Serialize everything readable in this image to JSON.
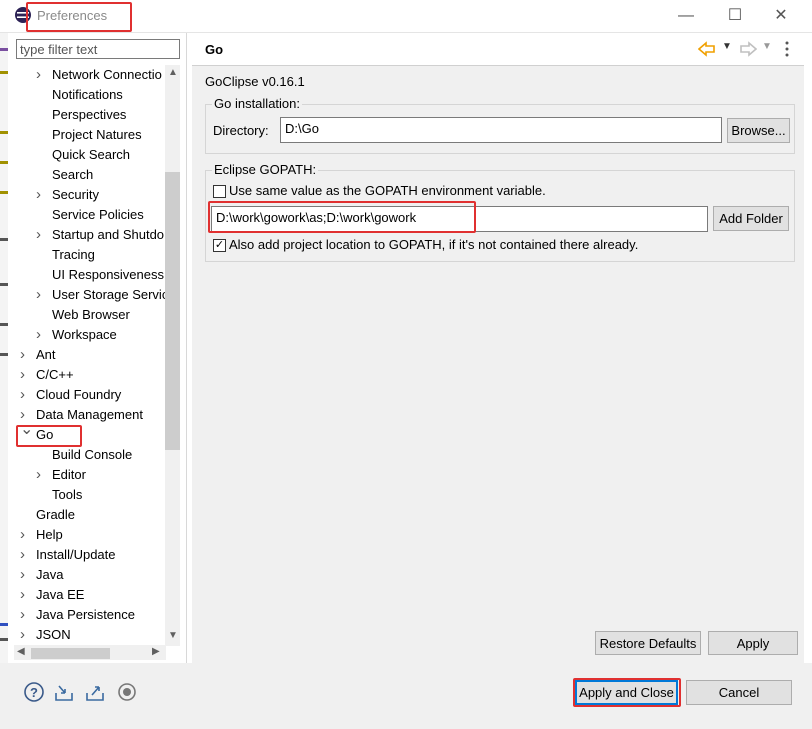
{
  "window": {
    "title": "Preferences",
    "minimize_glyph": "—",
    "maximize_glyph": "☐",
    "close_glyph": "✕"
  },
  "filter": {
    "placeholder": "type filter text"
  },
  "tree": [
    {
      "label": "Network Connectio",
      "level": 1,
      "twisty": "right"
    },
    {
      "label": "Notifications",
      "level": 1,
      "twisty": ""
    },
    {
      "label": "Perspectives",
      "level": 1,
      "twisty": ""
    },
    {
      "label": "Project Natures",
      "level": 1,
      "twisty": ""
    },
    {
      "label": "Quick Search",
      "level": 1,
      "twisty": ""
    },
    {
      "label": "Search",
      "level": 1,
      "twisty": ""
    },
    {
      "label": "Security",
      "level": 1,
      "twisty": "right"
    },
    {
      "label": "Service Policies",
      "level": 1,
      "twisty": ""
    },
    {
      "label": "Startup and Shutdo",
      "level": 1,
      "twisty": "right"
    },
    {
      "label": "Tracing",
      "level": 1,
      "twisty": ""
    },
    {
      "label": "UI Responsiveness",
      "level": 1,
      "twisty": ""
    },
    {
      "label": "User Storage Servic",
      "level": 1,
      "twisty": "right"
    },
    {
      "label": "Web Browser",
      "level": 1,
      "twisty": ""
    },
    {
      "label": "Workspace",
      "level": 1,
      "twisty": "right"
    },
    {
      "label": "Ant",
      "level": 0,
      "twisty": "right"
    },
    {
      "label": "C/C++",
      "level": 0,
      "twisty": "right"
    },
    {
      "label": "Cloud Foundry",
      "level": 0,
      "twisty": "right"
    },
    {
      "label": "Data Management",
      "level": 0,
      "twisty": "right"
    },
    {
      "label": "Go",
      "level": 0,
      "twisty": "down"
    },
    {
      "label": "Build Console",
      "level": 1,
      "twisty": ""
    },
    {
      "label": "Editor",
      "level": 1,
      "twisty": "right"
    },
    {
      "label": "Tools",
      "level": 1,
      "twisty": ""
    },
    {
      "label": "Gradle",
      "level": 0,
      "twisty": ""
    },
    {
      "label": "Help",
      "level": 0,
      "twisty": "right"
    },
    {
      "label": "Install/Update",
      "level": 0,
      "twisty": "right"
    },
    {
      "label": "Java",
      "level": 0,
      "twisty": "right"
    },
    {
      "label": "Java EE",
      "level": 0,
      "twisty": "right"
    },
    {
      "label": "Java Persistence",
      "level": 0,
      "twisty": "right"
    },
    {
      "label": "JSON",
      "level": 0,
      "twisty": "right"
    }
  ],
  "page": {
    "title": "Go",
    "version": "GoClipse v0.16.1",
    "install_group": {
      "title": "Go installation:",
      "directory_label": "Directory:",
      "directory_value": "D:\\Go",
      "browse": "Browse..."
    },
    "gopath_group": {
      "title": "Eclipse GOPATH:",
      "same_value_label": "Use same value as the GOPATH environment variable.",
      "same_value_checked": false,
      "gopath_value": "D:\\work\\gowork\\as;D:\\work\\gowork",
      "add_folder": "Add Folder",
      "add_project_label": "Also add project location to GOPATH, if it's not contained there already.",
      "add_project_checked": true
    },
    "restore_defaults": "Restore Defaults",
    "apply": "Apply"
  },
  "footer": {
    "apply_close": "Apply and Close",
    "cancel": "Cancel"
  },
  "icons": [
    "help-icon",
    "import-icon",
    "export-icon",
    "record-icon",
    "back-arrow-icon",
    "forward-arrow-icon",
    "dropdown-icon",
    "view-menu-icon"
  ],
  "colors": {
    "highlight": "#e03030",
    "back_arrow": "#f0a000",
    "primary_border": "#0078d7"
  }
}
